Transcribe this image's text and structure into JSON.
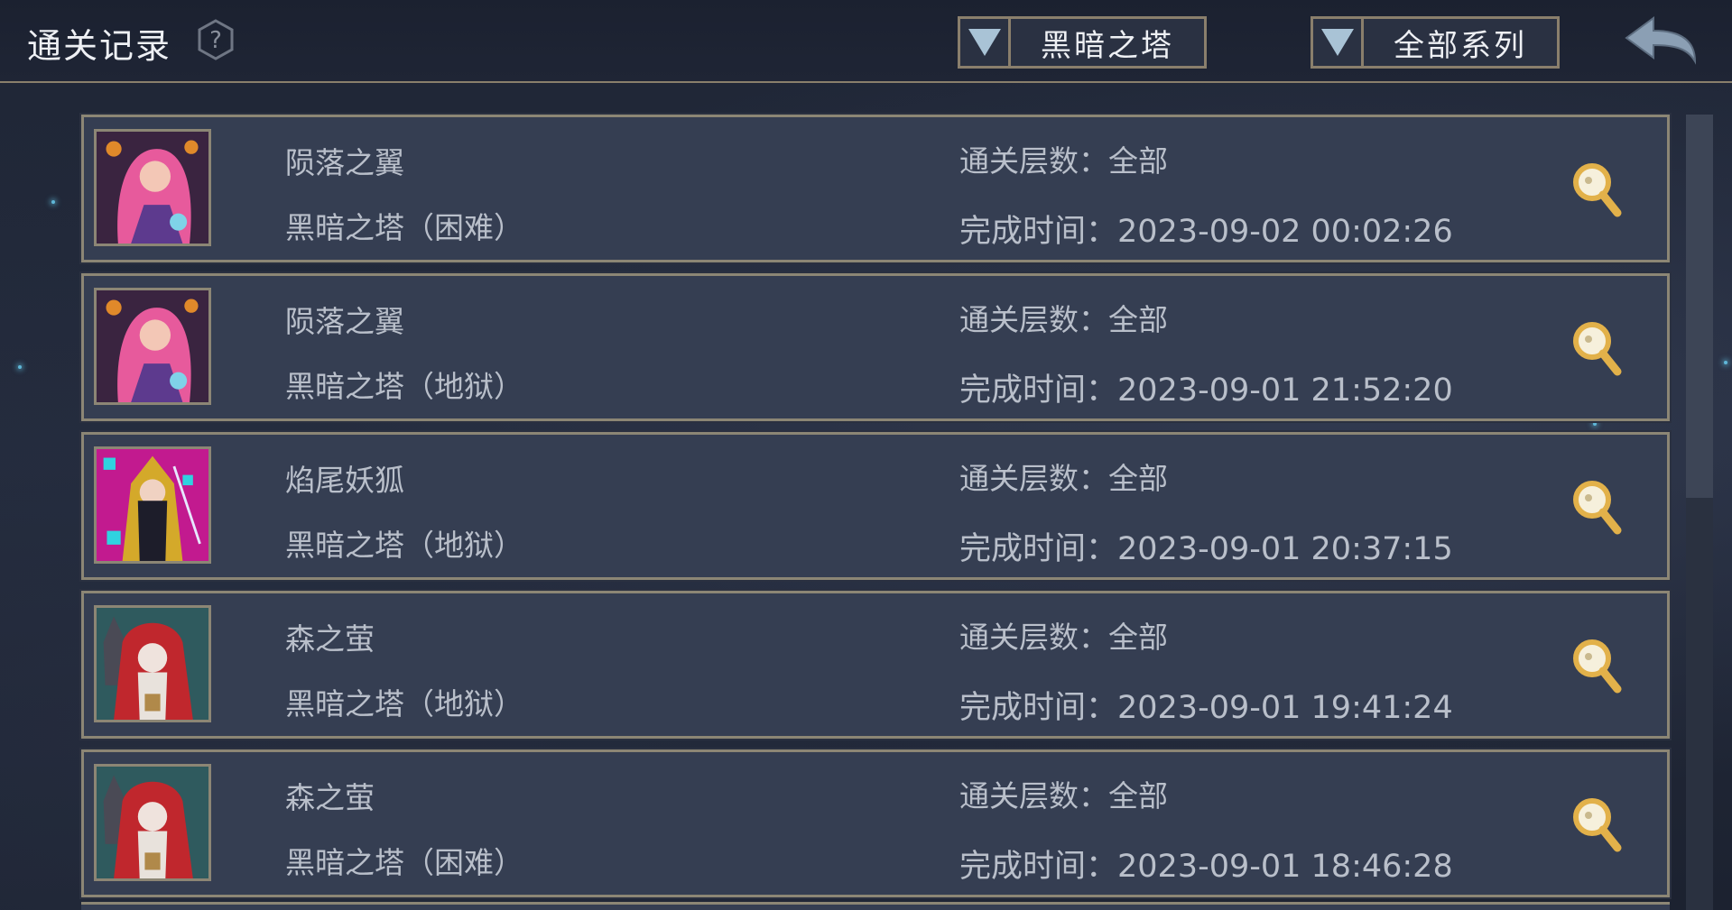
{
  "header": {
    "title": "通关记录",
    "tower_filter": "黑暗之塔",
    "series_filter": "全部系列"
  },
  "colors": {
    "background": "#1e2433",
    "card": "#353e52",
    "border": "#8c8675",
    "text": "#b9bfca",
    "magnifier": "#e2b14a"
  },
  "records": [
    {
      "avatar": "pink-haired-witch",
      "name": "陨落之翼",
      "mode": "黑暗之塔（困难）",
      "floors": "通关层数：全部",
      "time": "完成时间：2023-09-02 00:02:26"
    },
    {
      "avatar": "pink-haired-witch",
      "name": "陨落之翼",
      "mode": "黑暗之塔（地狱）",
      "floors": "通关层数：全部",
      "time": "完成时间：2023-09-01 21:52:20"
    },
    {
      "avatar": "fox-tail-archer",
      "name": "焰尾妖狐",
      "mode": "黑暗之塔（地狱）",
      "floors": "通关层数：全部",
      "time": "完成时间：2023-09-01 20:37:15"
    },
    {
      "avatar": "red-hood-girl",
      "name": "森之萤",
      "mode": "黑暗之塔（地狱）",
      "floors": "通关层数：全部",
      "time": "完成时间：2023-09-01 19:41:24"
    },
    {
      "avatar": "red-hood-girl",
      "name": "森之萤",
      "mode": "黑暗之塔（困难）",
      "floors": "通关层数：全部",
      "time": "完成时间：2023-09-01 18:46:28"
    }
  ]
}
